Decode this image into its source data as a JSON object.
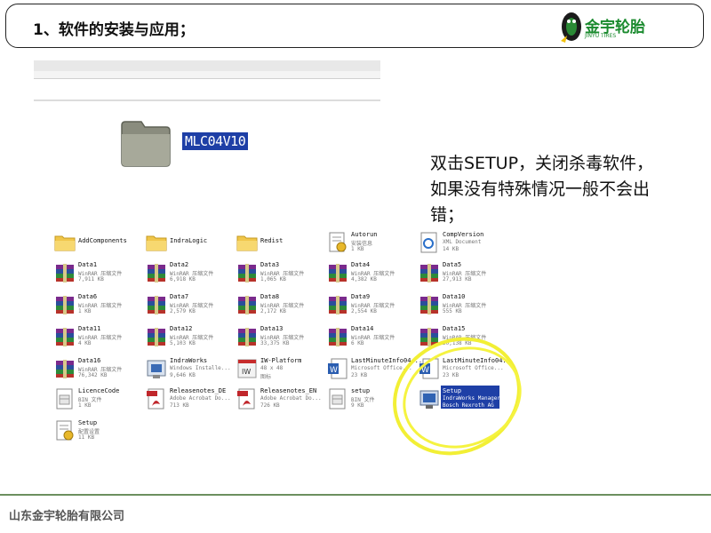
{
  "title": "1、软件的安装与应用；",
  "logo": {
    "name": "金宇轮胎",
    "sub": "JINYU TIRES"
  },
  "folder": {
    "name": "MLC04V10"
  },
  "note": "双击SETUP，关闭杀毒软件，如果没有特殊情况一般不会出错；",
  "footer": "山东金宇轮胎有限公司",
  "files": [
    {
      "name": "AddComponents",
      "d1": "",
      "d2": "",
      "icon": "folder-icon"
    },
    {
      "name": "IndraLogic",
      "d1": "",
      "d2": "",
      "icon": "folder-icon"
    },
    {
      "name": "Redist",
      "d1": "",
      "d2": "",
      "icon": "folder-icon"
    },
    {
      "name": "Autorun",
      "d1": "安装信息",
      "d2": "1 KB",
      "icon": "setup-info-icon"
    },
    {
      "name": "CompVersion",
      "d1": "XML Document",
      "d2": "14 KB",
      "icon": "xml-doc-icon"
    },
    {
      "name": "Data1",
      "d1": "WinRAR 压缩文件",
      "d2": "7,911 KB",
      "icon": "winrar-icon"
    },
    {
      "name": "Data2",
      "d1": "WinRAR 压缩文件",
      "d2": "6,918 KB",
      "icon": "winrar-icon"
    },
    {
      "name": "Data3",
      "d1": "WinRAR 压缩文件",
      "d2": "1,065 KB",
      "icon": "winrar-icon"
    },
    {
      "name": "Data4",
      "d1": "WinRAR 压缩文件",
      "d2": "4,382 KB",
      "icon": "winrar-icon"
    },
    {
      "name": "Data5",
      "d1": "WinRAR 压缩文件",
      "d2": "27,913 KB",
      "icon": "winrar-icon"
    },
    {
      "name": "Data6",
      "d1": "WinRAR 压缩文件",
      "d2": "1 KB",
      "icon": "winrar-icon"
    },
    {
      "name": "Data7",
      "d1": "WinRAR 压缩文件",
      "d2": "2,579 KB",
      "icon": "winrar-icon"
    },
    {
      "name": "Data8",
      "d1": "WinRAR 压缩文件",
      "d2": "2,172 KB",
      "icon": "winrar-icon"
    },
    {
      "name": "Data9",
      "d1": "WinRAR 压缩文件",
      "d2": "2,554 KB",
      "icon": "winrar-icon"
    },
    {
      "name": "Data10",
      "d1": "WinRAR 压缩文件",
      "d2": "555 KB",
      "icon": "winrar-icon"
    },
    {
      "name": "Data11",
      "d1": "WinRAR 压缩文件",
      "d2": "4 KB",
      "icon": "winrar-icon"
    },
    {
      "name": "Data12",
      "d1": "WinRAR 压缩文件",
      "d2": "5,103 KB",
      "icon": "winrar-icon"
    },
    {
      "name": "Data13",
      "d1": "WinRAR 压缩文件",
      "d2": "33,375 KB",
      "icon": "winrar-icon"
    },
    {
      "name": "Data14",
      "d1": "WinRAR 压缩文件",
      "d2": "6 KB",
      "icon": "winrar-icon"
    },
    {
      "name": "Data15",
      "d1": "WinRAR 压缩文件",
      "d2": "20,138 KB",
      "icon": "winrar-icon"
    },
    {
      "name": "Data16",
      "d1": "WinRAR 压缩文件",
      "d2": "76,342 KB",
      "icon": "winrar-icon"
    },
    {
      "name": "IndraWorks",
      "d1": "Windows Installe...",
      "d2": "9,646 KB",
      "icon": "msi-installer-icon"
    },
    {
      "name": "IW-Platform",
      "d1": "48 x 48",
      "d2": "图标",
      "icon": "iw-image-icon"
    },
    {
      "name": "LastMinuteInfo04...",
      "d1": "Microsoft Office...",
      "d2": "23 KB",
      "icon": "word-doc-icon"
    },
    {
      "name": "LastMinuteInfo04...",
      "d1": "Microsoft Office...",
      "d2": "23 KB",
      "icon": "word-doc-icon"
    },
    {
      "name": "LicenceCode",
      "d1": "BIN 文件",
      "d2": "1 KB",
      "icon": "bin-file-icon"
    },
    {
      "name": "Releasenotes_DE",
      "d1": "Adobe Acrobat Do...",
      "d2": "713 KB",
      "icon": "pdf-icon"
    },
    {
      "name": "Releasenotes_EN",
      "d1": "Adobe Acrobat Do...",
      "d2": "726 KB",
      "icon": "pdf-icon"
    },
    {
      "name": "setup",
      "d1": "BIN 文件",
      "d2": "9 KB",
      "icon": "bin-file-icon"
    },
    {
      "name": "Setup",
      "d1": "IndraWorks Manager",
      "d2": "Bosch Rexroth AG",
      "icon": "setup-exe-icon",
      "selected": true
    },
    {
      "name": "Setup",
      "d1": "配置设置",
      "d2": "11 KB",
      "icon": "setup-info-icon"
    }
  ]
}
